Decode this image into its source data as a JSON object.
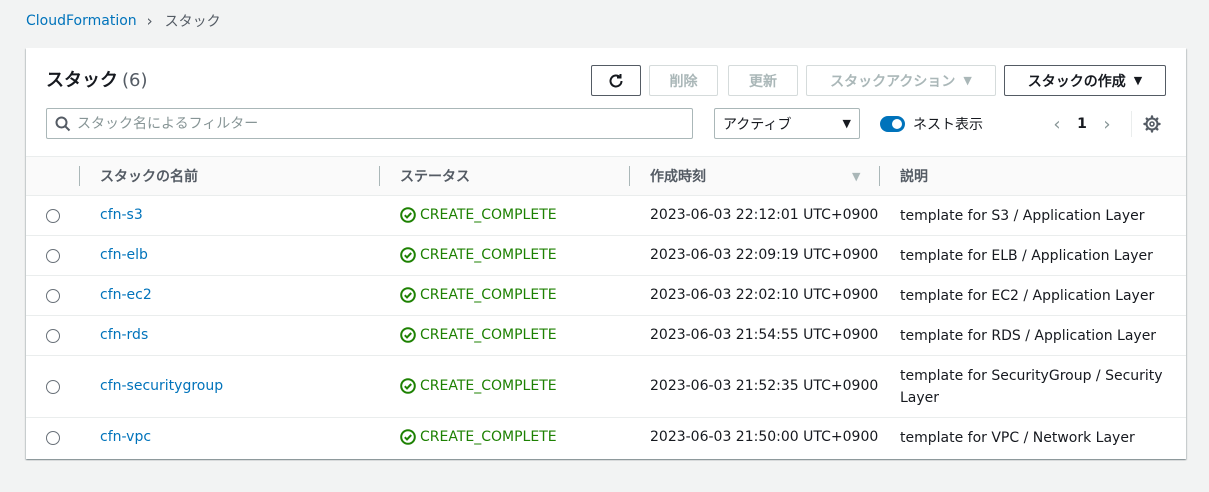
{
  "breadcrumb": {
    "root": "CloudFormation",
    "current": "スタック"
  },
  "panel": {
    "title": "スタック",
    "count": "(6)"
  },
  "toolbar": {
    "refresh_icon": "refresh-icon",
    "delete_label": "削除",
    "update_label": "更新",
    "stack_actions_label": "スタックアクション",
    "create_stack_label": "スタックの作成"
  },
  "filter": {
    "placeholder": "スタック名によるフィルター",
    "value": ""
  },
  "status_select": {
    "selected": "アクティブ"
  },
  "nested_toggle": {
    "label": "ネスト表示",
    "on": true
  },
  "pagination": {
    "current_page": "1"
  },
  "table": {
    "columns": [
      "スタックの名前",
      "ステータス",
      "作成時刻",
      "説明"
    ],
    "rows": [
      {
        "name": "cfn-s3",
        "status": "CREATE_COMPLETE",
        "created": "2023-06-03 22:12:01 UTC+0900",
        "description": "template for S3 / Application Layer"
      },
      {
        "name": "cfn-elb",
        "status": "CREATE_COMPLETE",
        "created": "2023-06-03 22:09:19 UTC+0900",
        "description": "template for ELB / Application Layer"
      },
      {
        "name": "cfn-ec2",
        "status": "CREATE_COMPLETE",
        "created": "2023-06-03 22:02:10 UTC+0900",
        "description": "template for EC2 / Application Layer"
      },
      {
        "name": "cfn-rds",
        "status": "CREATE_COMPLETE",
        "created": "2023-06-03 21:54:55 UTC+0900",
        "description": "template for RDS / Application Layer"
      },
      {
        "name": "cfn-securitygroup",
        "status": "CREATE_COMPLETE",
        "created": "2023-06-03 21:52:35 UTC+0900",
        "description": "template for SecurityGroup / Security Layer"
      },
      {
        "name": "cfn-vpc",
        "status": "CREATE_COMPLETE",
        "created": "2023-06-03 21:50:00 UTC+0900",
        "description": "template for VPC / Network Layer"
      }
    ]
  },
  "colors": {
    "link": "#0073bb",
    "success": "#1d8102",
    "disabled": "#aab7b8"
  }
}
